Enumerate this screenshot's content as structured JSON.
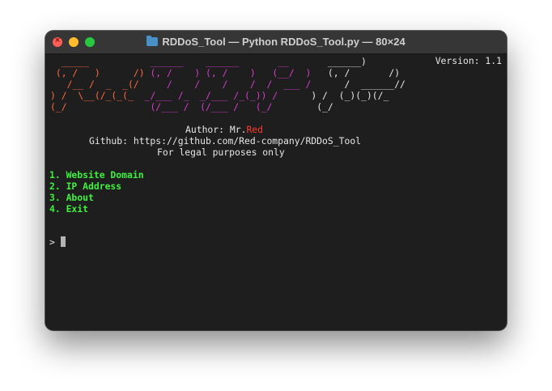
{
  "window": {
    "title": "RDDoS_Tool — Python RDDoS_Tool.py — 80×24"
  },
  "terminal": {
    "version": "Version: 1.1",
    "banner": {
      "line1": {
        "orange": "  _____",
        "pink": "           ______    ______       __",
        "white": "       ______)"
      },
      "line2": {
        "orange": " (, /   )      /)",
        "pink": " (, /    ) (, /    )   (__/  )",
        "white": "   (, /       /)"
      },
      "line3": {
        "orange": "   /__ /  _  _(/ ",
        "pink": "    /    /    /    /  /  ___ /",
        "white": "      /  ______//"
      },
      "line4": {
        "orange": ") /  \\__(/_(_(_ ",
        "pink": " _/___ /_  _/___ /_(_)) /",
        "white": "      ) /  (_)(_)(/_"
      },
      "line5": {
        "orange": "(_/",
        "pink": "               (/___ /  (/___ /   (_/",
        "white": "        (_/"
      }
    },
    "author_prefix": "Author: Mr.",
    "author_name": "Red",
    "github": "Github: https://github.com/Red-company/RDDoS_Tool",
    "legal": "For legal purposes only",
    "menu": [
      "1. Website Domain",
      "2. IP Address",
      "3. About",
      "4. Exit"
    ],
    "prompt": ">"
  }
}
